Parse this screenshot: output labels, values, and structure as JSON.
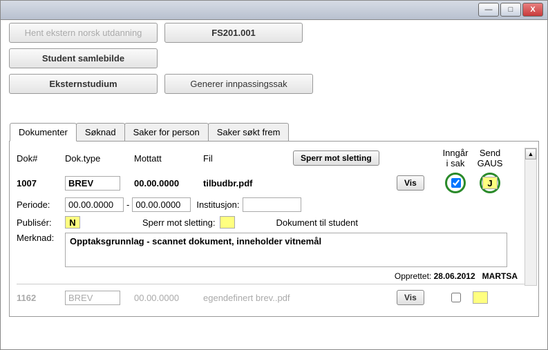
{
  "titlebar": {
    "min": "—",
    "max": "□",
    "close": "X"
  },
  "buttons": {
    "hent_ekstern": "Hent ekstern norsk utdanning",
    "fs201": "FS201.001",
    "student_samlebilde": "Student samlebilde",
    "eksternstudium": "Eksternstudium",
    "generer": "Generer innpassingssak"
  },
  "tabs": {
    "dokumenter": "Dokumenter",
    "soknad": "Søknad",
    "saker_person": "Saker for person",
    "saker_sokt": "Saker søkt frem"
  },
  "headers": {
    "dok": "Dok#",
    "doktype": "Dok.type",
    "mottatt": "Mottatt",
    "fil": "Fil",
    "sperr_btn": "Sperr mot sletting",
    "inngar": "Inngår",
    "isak": "i sak",
    "send": "Send",
    "gaus": "GAUS"
  },
  "doc1": {
    "num": "1007",
    "type": "BREV",
    "mottatt": "00.00.0000",
    "fil": "tilbudbr.pdf",
    "vis": "Vis",
    "gaus_val": "J"
  },
  "periode": {
    "label": "Periode:",
    "from": "00.00.0000",
    "dash": "-",
    "to": "00.00.0000",
    "inst_label": "Institusjon:"
  },
  "publiser": {
    "label": "Publisér:",
    "val": "N",
    "sperr_label": "Sperr mot sletting:",
    "dok_student": "Dokument til student"
  },
  "merknad": {
    "label": "Merknad:",
    "text": "Opptaksgrunnlag - scannet dokument, inneholder vitnemål"
  },
  "footer": {
    "opprettet_label": "Opprettet:",
    "date": "28.06.2012",
    "user": "MARTSA"
  },
  "doc2": {
    "num": "1162",
    "type": "BREV",
    "mottatt": "00.00.0000",
    "fil": "egendefinert brev..pdf",
    "vis": "Vis"
  }
}
